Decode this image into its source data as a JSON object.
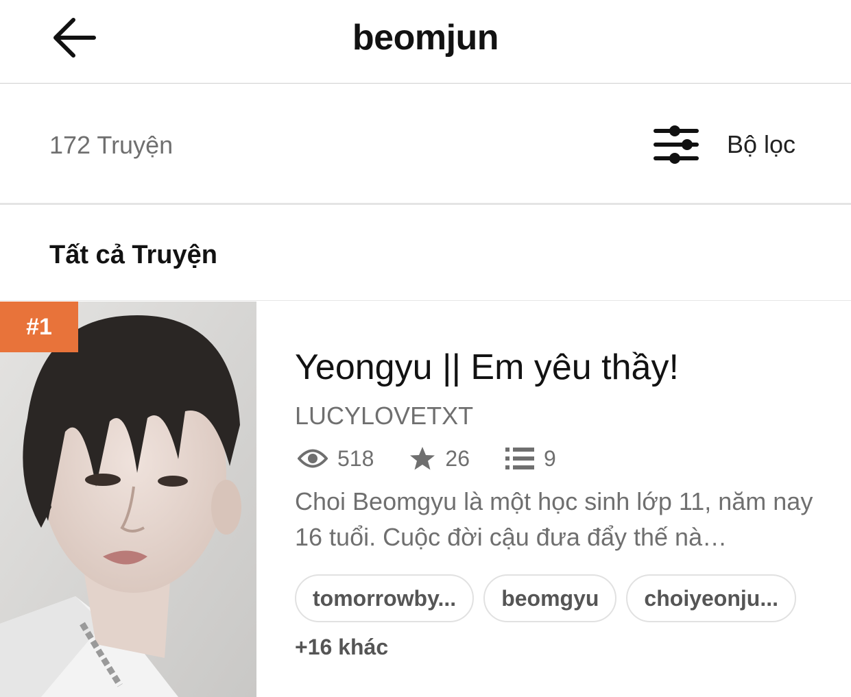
{
  "header": {
    "title": "beomjun",
    "back_icon": "arrow-left-icon"
  },
  "filter_bar": {
    "count_label": "172 Truyện",
    "filter_label": "Bộ lọc",
    "filter_icon": "sliders-icon"
  },
  "section": {
    "title": "Tất cả Truyện"
  },
  "story": {
    "rank": "#1",
    "rank_color": "#e8733a",
    "title": "Yeongyu || Em yêu thầy!",
    "author": "LUCYLOVETXT",
    "stats": {
      "reads": "518",
      "votes": "26",
      "parts": "9"
    },
    "description": "Choi Beomgyu là một học sinh lớp 11, năm nay 16 tuổi. Cuộc đời cậu đưa đẩy thế nà…",
    "tags": [
      "tomorrowby...",
      "beomgyu",
      "choiyeonju..."
    ],
    "more_tags": "+16 khác"
  }
}
